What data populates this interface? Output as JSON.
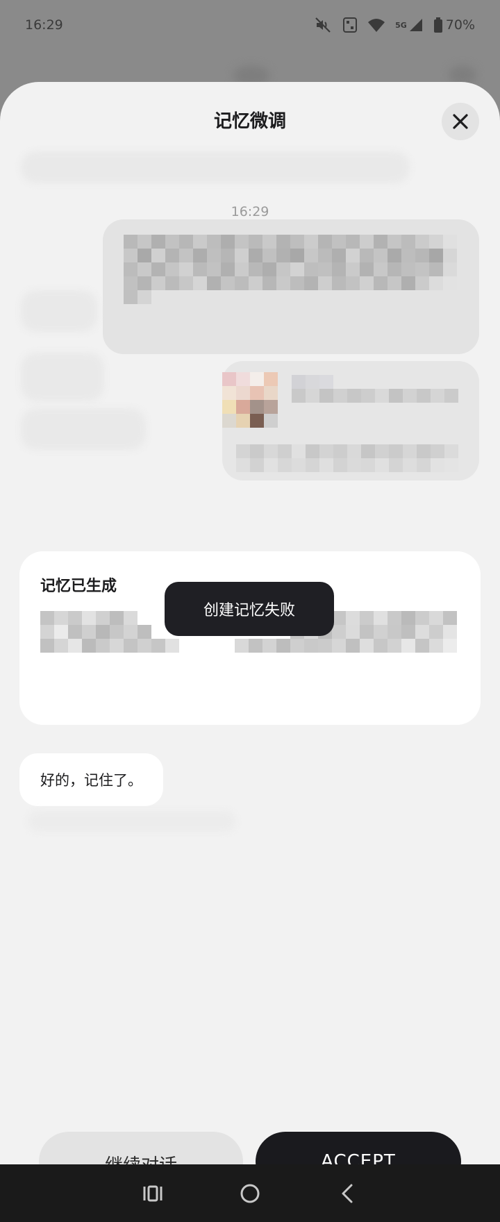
{
  "status_bar": {
    "time": "16:29",
    "network_label": "5G",
    "battery": "70%"
  },
  "sheet": {
    "title": "记忆微调",
    "close_icon": "close-icon"
  },
  "chat": {
    "timestamp": "16:29",
    "memory_card_title": "记忆已生成",
    "reply_text": "好的，记住了。"
  },
  "toast": {
    "text": "创建记忆失败"
  },
  "actions": {
    "continue_label": "继续对话",
    "accept_label": "ACCEPT"
  },
  "nav": {
    "recents_icon": "recents-icon",
    "home_icon": "home-icon",
    "back_icon": "back-icon"
  },
  "colors": {
    "sheet_bg": "#f2f2f2",
    "toast_bg": "#1f1f24",
    "accept_bg": "#1a1a1e",
    "continue_bg": "#e3e3e3"
  }
}
